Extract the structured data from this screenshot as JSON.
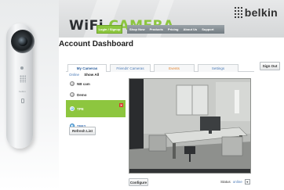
{
  "header": {
    "product_prefix": "WiFi ",
    "product_accent": "CAMERA",
    "brand": "belkin",
    "login_label": "Login / Signup",
    "nav_items": [
      "Shop Now",
      "Products",
      "Pricing",
      "About Us",
      "Support"
    ]
  },
  "hero": {
    "brand_text": "belkin"
  },
  "page": {
    "title": "Account Dashboard"
  },
  "tabs": [
    {
      "label": "My Cameras"
    },
    {
      "label": "Friends' Cameras"
    },
    {
      "label": "Events"
    },
    {
      "label": "Settings"
    }
  ],
  "signout_label": "Sign Out",
  "filters": {
    "online": "Online",
    "show_all": "Show All"
  },
  "cameras": [
    {
      "name": "NB cam"
    },
    {
      "name": "Demo"
    },
    {
      "name": "TPE"
    },
    {
      "name": "TPE2"
    }
  ],
  "refresh_label": "Refresh List",
  "configure_label": "Configure",
  "status": {
    "label": "Status",
    "value": "online"
  },
  "colors": {
    "accent_green": "#8cc63f",
    "link_blue": "#4a7ab7",
    "delete_red": "#d9352a",
    "events_orange": "#e2812a"
  }
}
